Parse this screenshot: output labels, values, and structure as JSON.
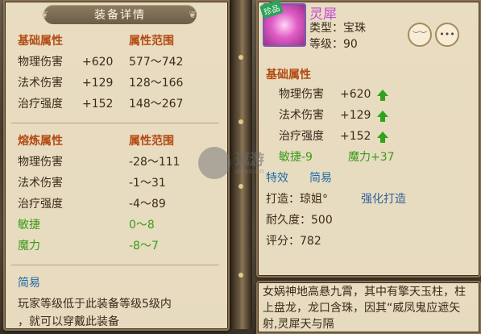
{
  "left_panel": {
    "title": "装备详情",
    "base": {
      "header_name": "基础属性",
      "header_range": "属性范围",
      "rows": [
        {
          "name": "物理伤害",
          "value": "+620",
          "range": "577～742"
        },
        {
          "name": "法术伤害",
          "value": "+129",
          "range": "128～166"
        },
        {
          "name": "治疗强度",
          "value": "+152",
          "range": "148～267"
        }
      ]
    },
    "refine": {
      "header_name": "熔炼属性",
      "header_range": "属性范围",
      "rows": [
        {
          "name": "物理伤害",
          "range": "-28～111"
        },
        {
          "name": "法术伤害",
          "range": "-1～31"
        },
        {
          "name": "治疗强度",
          "range": "-4～89"
        },
        {
          "name": "敏捷",
          "range": "0～8"
        },
        {
          "name": "魔力",
          "range": "-8～7"
        }
      ]
    },
    "brief": {
      "header": "简易",
      "line1": "玩家等级低于此装备等级5级内",
      "line2": "，就可以穿戴此装备"
    }
  },
  "right_panel": {
    "badge": "珍品",
    "name": "灵犀",
    "type_label": "类型：宝珠",
    "level_label": "等级：90",
    "buttons": {
      "eye": "︶︶",
      "more": "•••"
    },
    "base_header": "基础属性",
    "base_rows": [
      {
        "name": "物理伤害",
        "value": "+620"
      },
      {
        "name": "法术伤害",
        "value": "+129"
      },
      {
        "name": "治疗强度",
        "value": "+152"
      }
    ],
    "extra": {
      "agility": "敏捷-9",
      "magic": "魔力+37"
    },
    "special": {
      "effect": "特效",
      "brief": "简易"
    },
    "forge": {
      "label": "打造：琼姐°",
      "button": "强化打造"
    },
    "durability": "耐久度：500",
    "score": "评分：782",
    "description": "女娲神地高悬九霄，其中有擎天玉柱，柱上盘龙，龙口含珠，因其“威凤鬼应遮矢射,灵犀天与隔"
  },
  "watermark": {
    "text": "逗游",
    "url": "doyo.cn"
  },
  "colors": {
    "header": "#b24a12",
    "green": "#3a9a1a",
    "blue": "#1f6aa6",
    "item_name": "#c04ad6"
  }
}
